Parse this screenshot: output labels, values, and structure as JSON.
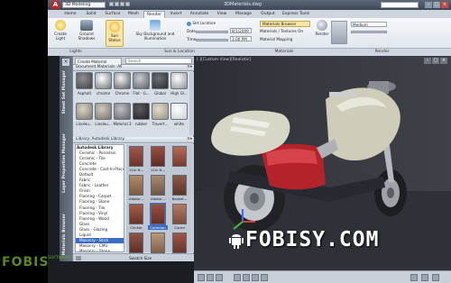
{
  "titlebar": {
    "workspace": "3D Modeling",
    "window_title": "3DMaterials.dwg",
    "search_placeholder": ""
  },
  "ribbon_tabs": [
    "Home",
    "Solid",
    "Surface",
    "Mesh",
    "Render",
    "Insert",
    "Annotate",
    "View",
    "Manage",
    "Output",
    "Express Tools"
  ],
  "active_tab": "Render",
  "ribbon": {
    "create_light": "Create Light",
    "ground_shadows": "Ground Shadows",
    "sun_status": "Sun Status",
    "sky_background": "Sky Background and Illumination",
    "set_location": "Set Location",
    "date": "8/1/2009",
    "time": "3:00 PM",
    "materials_browser": "Materials Browser",
    "materials_textures_on": "Materials / Textures On",
    "material_mapping": "Material Mapping",
    "render": "Render",
    "render_preset": "Medium",
    "panel_lights": "Lights",
    "panel_sun": "Sun & Location",
    "panel_materials": "Materials",
    "panel_render": "Render"
  },
  "palette": {
    "strip_labels": [
      "Sheet Set Manager",
      "Layer Properties Manager",
      "Materials Browser"
    ],
    "create_material": "Create Material",
    "search_placeholder": "Search",
    "doc_materials_header": "Document Materials: All",
    "doc_materials": [
      "Asphalt",
      "chrome",
      "Chrome",
      "Flat - G...",
      "Global",
      "High Gl...",
      "Linoleu...",
      "Linoleu...",
      "Material 3",
      "rubber",
      "Travert...",
      "white"
    ],
    "library_header": "Library: Autodesk Library",
    "library_tree": [
      {
        "label": "Autodesk Library",
        "head": true
      },
      {
        "label": "Ceramic - Porcelain"
      },
      {
        "label": "Ceramic - Tile"
      },
      {
        "label": "Concrete"
      },
      {
        "label": "Concrete - Cast-In-Place"
      },
      {
        "label": "Default"
      },
      {
        "label": "Fabric"
      },
      {
        "label": "Fabric - Leather"
      },
      {
        "label": "Finish"
      },
      {
        "label": "Flooring - Carpet"
      },
      {
        "label": "Flooring - Stone"
      },
      {
        "label": "Flooring - Tile"
      },
      {
        "label": "Flooring - Vinyl"
      },
      {
        "label": "Flooring - Wood"
      },
      {
        "label": "Glass"
      },
      {
        "label": "Glass - Glazing"
      },
      {
        "label": "Liquid"
      },
      {
        "label": "Masonry - Brick",
        "selected": true
      },
      {
        "label": "Masonry - CMU"
      },
      {
        "label": "Masonry - Stone"
      }
    ],
    "library_swatches": [
      "12in N...",
      "12in N...",
      "",
      "Adobe...",
      "Adobe...",
      "Basket...",
      "Clinker",
      "Common",
      "Cored",
      "Cross...",
      "Decora...",
      "English"
    ],
    "selected_swatch": "Common",
    "swatch_size": "Swatch Size"
  },
  "viewport": {
    "label": "[-][Custom View][Realistic]"
  },
  "watermarks": {
    "left": "FOBIS",
    "left_sub": "SOFTWARE",
    "right": "FOBISY.COM"
  },
  "colors": {
    "accent_blue": "#3b6ec2",
    "autocad_red": "#c4252b",
    "viewport_bg": "#35393f"
  }
}
